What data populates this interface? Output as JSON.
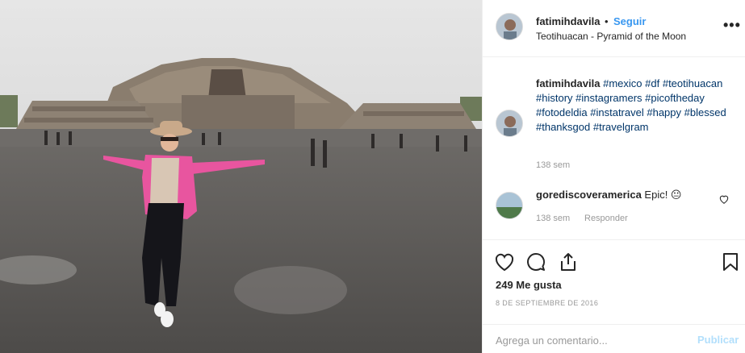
{
  "post": {
    "username": "fatimihdavila",
    "separator": "•",
    "follow_label": "Seguir",
    "location": "Teotihuacan - Pyramid of the Moon",
    "more_icon": "more-options-icon",
    "more_label": "•••"
  },
  "caption": {
    "username": "fatimihdavila",
    "hashtags": [
      "#mexico",
      "#df",
      "#teotihuacan",
      "#history",
      "#instagramers",
      "#picoftheday",
      "#fotodeldia",
      "#instatravel",
      "#happy",
      "#blessed",
      "#thanksgod",
      "#travelgram"
    ],
    "time": "138 sem"
  },
  "comment": {
    "username": "gorediscoveramerica",
    "text": "Epic! 😐",
    "time": "138 sem",
    "reply_label": "Responder"
  },
  "actions": {
    "like_icon": "heart-icon",
    "comment_icon": "comment-icon",
    "share_icon": "share-icon",
    "save_icon": "bookmark-icon"
  },
  "likes": "249 Me gusta",
  "date": "8 DE SEPTIEMBRE DE 2016",
  "comment_box": {
    "placeholder": "Agrega un comentario...",
    "publish_label": "Publicar"
  },
  "colors": {
    "link": "#3897f0",
    "hashtag": "#003569",
    "muted": "#999999",
    "publish_disabled": "#b2dffc",
    "jacket": "#e8559f"
  }
}
